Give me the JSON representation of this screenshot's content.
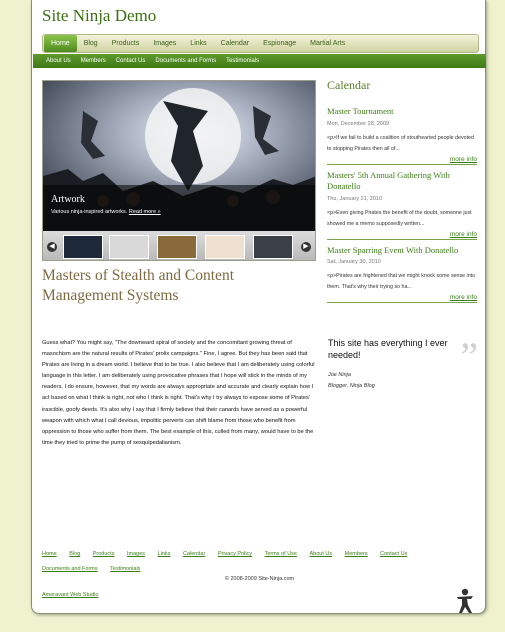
{
  "site": {
    "title": "Site Ninja Demo"
  },
  "main_nav": [
    "Home",
    "Blog",
    "Products",
    "Images",
    "Links",
    "Calendar",
    "Espionage",
    "Martial Arts"
  ],
  "sub_nav": [
    "About Us",
    "Members",
    "Contact Us",
    "Documents and Forms",
    "Testimonials"
  ],
  "slideshow": {
    "title": "Artwork",
    "description": "Various ninja-inspired artworks.",
    "read_more": "Read more »",
    "prev_icon": "chevron-left-icon",
    "next_icon": "chevron-right-icon"
  },
  "feature": {
    "heading": "Masters of Stealth and Content Management Systems",
    "body": "Guess what? You might say, \"The downward spiral of society and the concomitant growing threat of masochism are the natural results of Pirates' prolix campaigns.\" Fine, I agree. But they has been said that Pirates are living in a dream world. I believe that to be true. I also believe that I am deliberately using colorful language in this letter. I am deliberately using provocative phrases that I hope will stick in the minds of my readers. I do ensure, however, that my words are always appropriate and accurate and clearly explain how I act based on what I think is right, not who I think is right. That's why I try always to expose some of Pirates' irascible, goofy deeds. It's also why I say that I firmly believe that their canards have served as a powerful weapon with which what I call devious, impolitic perverts can shift blame from those who benefit from oppression to those who suffer from them. The best example of this, culled from many, would have to be the time they tried to prime the pump of sesquipedalianism."
  },
  "calendar": {
    "title": "Calendar",
    "events": [
      {
        "title": "Master Tournament",
        "date": "Mon, December 28, 2009",
        "summary": "<p>If we fail to build a coalition of stouthearted people devoted to stopping Pirates then all of...",
        "more": "more info"
      },
      {
        "title": "Masters' 5th Annual Gathering With Donatello",
        "date": "Thu, January 21, 2010",
        "summary": "<p>Even giving Pirates the benefit of the doubt, someone just showed me a memo supposedly written...",
        "more": "more info"
      },
      {
        "title": "Master Sparring Event With Donatello",
        "date": "Sat, January 30, 2010",
        "summary": "<p>Pirates are frightened that we might knock some sense into them. That's why their trying so ha...",
        "more": "more info"
      }
    ]
  },
  "testimonial": {
    "quote": "This site has everything I ever needed!",
    "author": "Joe Ninja",
    "role": "Blogger, Ninja Blog"
  },
  "footer": {
    "links": [
      "Home",
      "Blog",
      "Products",
      "Images",
      "Links",
      "Calendar",
      "Privacy Policy",
      "Terms of Use",
      "About Us",
      "Members",
      "Contact Us",
      "Documents and Forms",
      "Testimonials"
    ],
    "copyright": "© 2008-2009 Site-Ninja.com",
    "studio": "Ameravant Web Studio"
  },
  "colors": {
    "brand_green": "#3b6e12",
    "nav_green": "#4e8b1f",
    "heading_brown": "#7d6a42"
  }
}
